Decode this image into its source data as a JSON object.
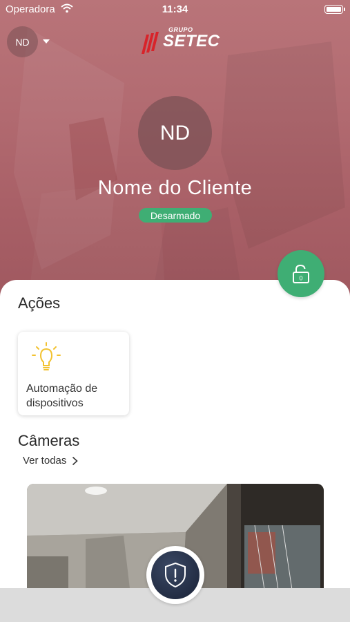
{
  "statusbar": {
    "carrier": "Operadora",
    "time": "11:34"
  },
  "header": {
    "user_initials": "ND",
    "logo_small": "GRUPO",
    "logo_main": "SETEC"
  },
  "profile": {
    "initials": "ND",
    "name": "Nome do Cliente",
    "status": "Desarmado",
    "lock_count": "0"
  },
  "actions": {
    "title": "Ações",
    "items": [
      {
        "label": "Automação de dispositivos",
        "icon": "lightbulb-icon"
      }
    ]
  },
  "cameras": {
    "title": "Câmeras",
    "see_all": "Ver todas"
  },
  "colors": {
    "accent_green": "#3fae74",
    "hero": "#b26b71",
    "panic": "#232d44"
  }
}
